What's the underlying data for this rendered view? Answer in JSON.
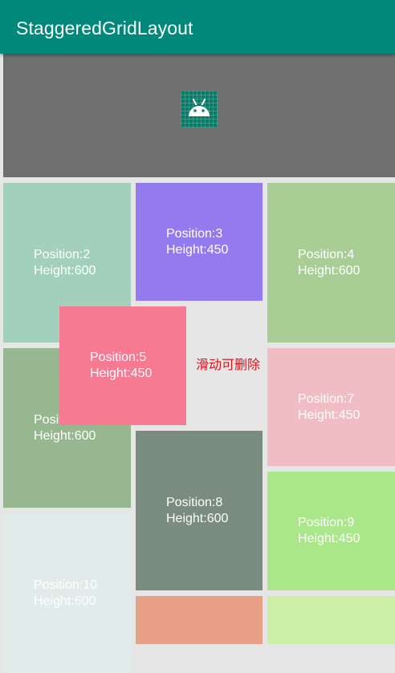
{
  "appbar": {
    "title": "StaggeredGridLayout"
  },
  "header": {
    "icon": "android-app-icon"
  },
  "items": [
    {
      "pos": "Position:2",
      "h": "Height:600",
      "color": "#a3d0bd"
    },
    {
      "pos": "Position:3",
      "h": "Height:450",
      "color": "#937bef"
    },
    {
      "pos": "Position:4",
      "h": "Height:600",
      "color": "#a8ce96"
    },
    {
      "pos": "Position:6",
      "h": "Height:600",
      "color": "#96b78f"
    },
    {
      "pos": "Position:5",
      "h": "Height:450",
      "color": "#f77a93"
    },
    {
      "pos": "Position:7",
      "h": "Height:450",
      "color": "#f0bec2"
    },
    {
      "pos": "Position:8",
      "h": "Height:600",
      "color": "#7a8b80"
    },
    {
      "pos": "Position:9",
      "h": "Height:450",
      "color": "#aae68a"
    },
    {
      "pos": "Position:10",
      "h": "Height:600",
      "color": "#e1ebea"
    },
    {
      "color": "#e9a088"
    },
    {
      "color": "#ccefa8"
    }
  ],
  "swipe_hint": "滑动可删除"
}
